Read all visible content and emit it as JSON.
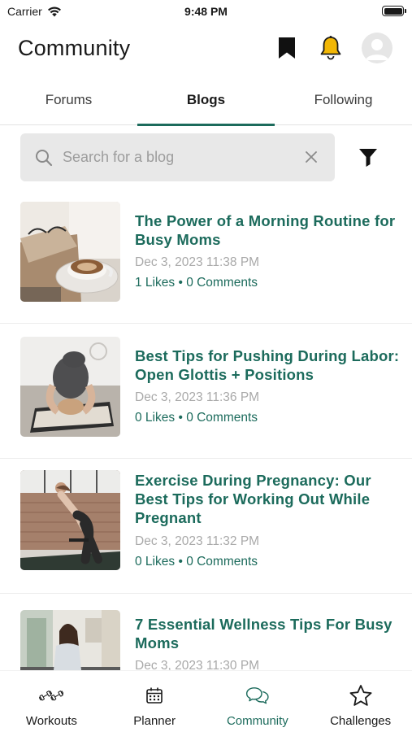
{
  "status_bar": {
    "carrier": "Carrier",
    "time": "9:48 PM"
  },
  "header": {
    "title": "Community"
  },
  "tabs": [
    {
      "label": "Forums"
    },
    {
      "label": "Blogs"
    },
    {
      "label": "Following"
    }
  ],
  "search": {
    "placeholder": "Search for a blog",
    "value": ""
  },
  "blogs": [
    {
      "title": "The Power of a Morning Routine for Busy Moms",
      "date": "Dec 3, 2023 11:38 PM",
      "likes": "1 Likes",
      "comments": "0 Comments",
      "separator": "•"
    },
    {
      "title": "Best Tips for Pushing During Labor: Open Glottis + Positions",
      "date": "Dec 3, 2023 11:36 PM",
      "likes": "0 Likes",
      "comments": "0 Comments",
      "separator": "•"
    },
    {
      "title": "Exercise During Pregnancy: Our Best Tips for Working Out While Pregnant",
      "date": "Dec 3, 2023 11:32 PM",
      "likes": "0 Likes",
      "comments": "0 Comments",
      "separator": "•"
    },
    {
      "title": "7 Essential Wellness Tips For Busy Moms",
      "date": "Dec 3, 2023 11:30 PM",
      "likes": "",
      "comments": "",
      "separator": ""
    }
  ],
  "bottom_nav": [
    {
      "label": "Workouts",
      "icon": "dumbbell-icon"
    },
    {
      "label": "Planner",
      "icon": "calendar-icon"
    },
    {
      "label": "Community",
      "icon": "chat-bubbles-icon",
      "active": true
    },
    {
      "label": "Challenges",
      "icon": "star-icon"
    }
  ],
  "colors": {
    "accent": "#1c6b5c",
    "bell": "#f2b705",
    "muted": "#a9a9a9"
  }
}
